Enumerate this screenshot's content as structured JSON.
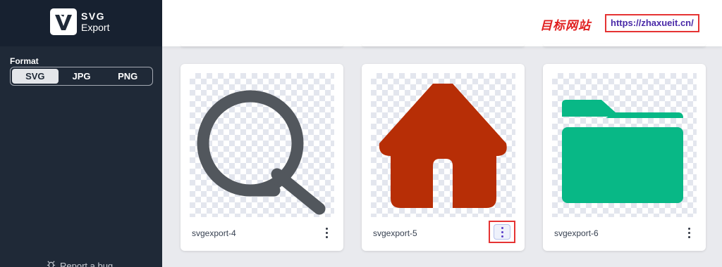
{
  "app": {
    "logo_line1": "SVG",
    "logo_line2": "Export"
  },
  "sidebar": {
    "format_label": "Format",
    "formats": [
      "SVG",
      "JPG",
      "PNG"
    ],
    "selected_format": "SVG",
    "report_bug": "Report a bug"
  },
  "header": {
    "site_label": "目标网站",
    "site_url": "https://zhaxueit.cn/"
  },
  "cards": [
    {
      "name": "svgexport-4",
      "icon": "search-icon",
      "color": "#52575d"
    },
    {
      "name": "svgexport-5",
      "icon": "home-icon",
      "color": "#b72e06"
    },
    {
      "name": "svgexport-6",
      "icon": "folder-icon",
      "color": "#08b886"
    }
  ],
  "colors": {
    "sidebar_bg": "#1f2937",
    "accent_purple": "#5a3ec8",
    "highlight_red": "#e53333"
  }
}
